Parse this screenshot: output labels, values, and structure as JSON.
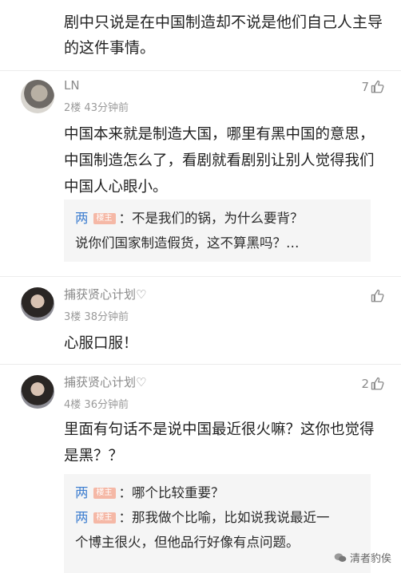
{
  "top_comment_tail": "剧中只说是在中国制造却不说是他们自己人主导的这件事情。",
  "comments": [
    {
      "author": "LN",
      "floor": "2楼",
      "time": "43分钟前",
      "likes": "7",
      "text": "中国本来就是制造大国，哪里有黑中国的意思，中国制造怎么了，看剧就看剧别让别人觉得我们中国人心眼小。",
      "replies": [
        {
          "name": "两",
          "badge": "楼主",
          "text": "：不是我们的锅，为什么要背？",
          "cont": "说你们国家制造假货，这不算黑吗？…"
        }
      ]
    },
    {
      "author": "捕获贤心计划♡",
      "floor": "3楼",
      "time": "38分钟前",
      "likes": "",
      "text": "心服口服！"
    },
    {
      "author": "捕获贤心计划♡",
      "floor": "4楼",
      "time": "36分钟前",
      "likes": "2",
      "text": "里面有句话不是说中国最近很火嘛？这你也觉得是黑？？",
      "replies": [
        {
          "name": "两",
          "badge": "楼主",
          "text": "：哪个比较重要？",
          "cont": ""
        },
        {
          "name": "两",
          "badge": "楼主",
          "text": "：那我做个比喻，比如说我说最近一",
          "cont": "个博主很火，但他品行好像有点问题。"
        }
      ]
    }
  ],
  "watermark": "清者豹俟"
}
